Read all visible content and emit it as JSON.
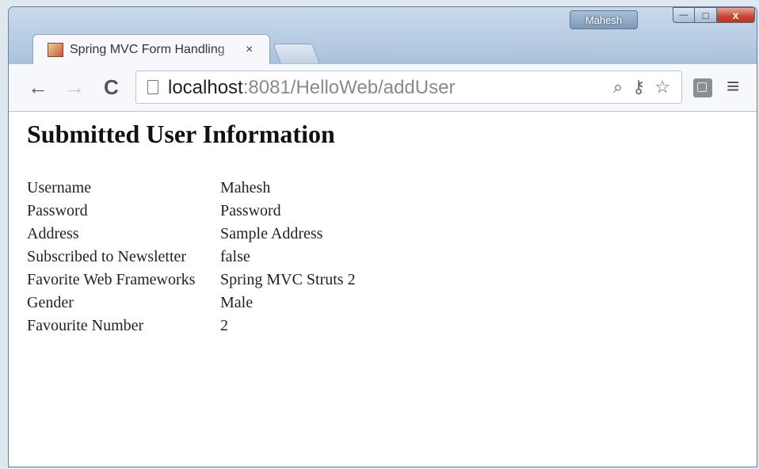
{
  "window": {
    "user_badge": "Mahesh",
    "minimize_glyph": "—",
    "maximize_glyph": "□",
    "close_glyph": "x"
  },
  "tab": {
    "title": "Spring MVC Form Handling",
    "close_glyph": "×",
    "icon": "jsp-file-icon"
  },
  "toolbar": {
    "back_glyph": "←",
    "forward_glyph": "→",
    "reload_glyph": "C",
    "url_host": "localhost",
    "url_rest": ":8081/HelloWeb/addUser",
    "zoom_glyph": "⌕",
    "key_glyph": "⚷",
    "star_glyph": "☆",
    "menu_glyph": "≡"
  },
  "page": {
    "heading": "Submitted User Information",
    "rows": [
      {
        "label": "Username",
        "value": "Mahesh"
      },
      {
        "label": "Password",
        "value": "Password"
      },
      {
        "label": "Address",
        "value": "Sample Address"
      },
      {
        "label": "Subscribed to Newsletter",
        "value": "false"
      },
      {
        "label": "Favorite Web Frameworks",
        "value": "Spring MVC Struts 2"
      },
      {
        "label": "Gender",
        "value": "Male"
      },
      {
        "label": "Favourite Number",
        "value": "2"
      }
    ]
  }
}
